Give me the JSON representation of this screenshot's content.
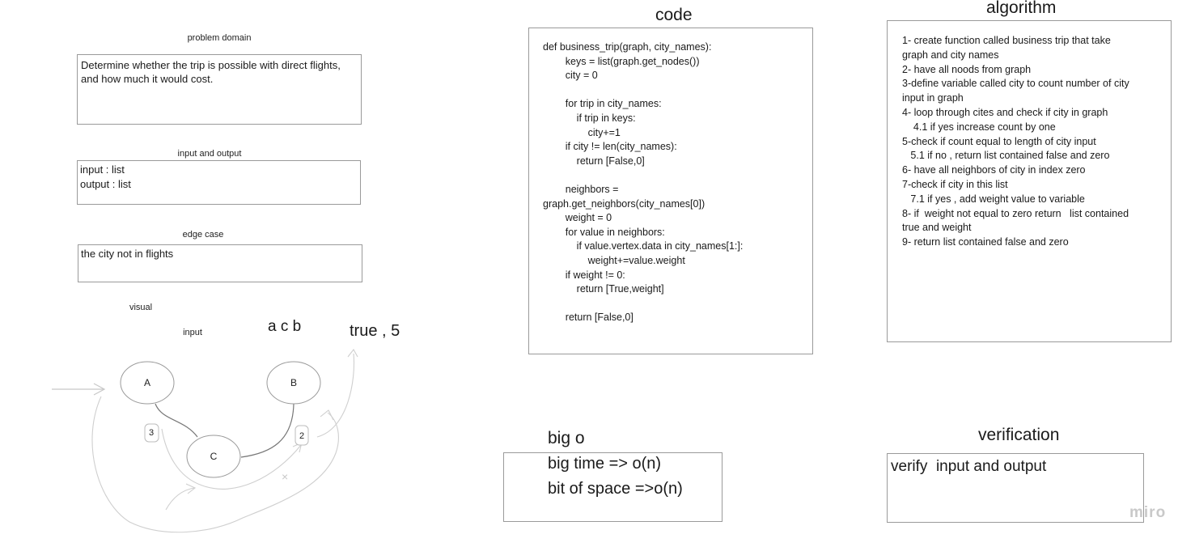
{
  "problem_domain": {
    "label": "problem domain",
    "text": "Determine whether the trip is possible with direct flights, and how much it would cost."
  },
  "input_output": {
    "label": "input and output",
    "lines": [
      "input : list",
      "output : list"
    ]
  },
  "edge_case": {
    "label": "edge case",
    "text": "the city not in flights"
  },
  "visual": {
    "label": "visual",
    "input_label": "input",
    "input_value": "a c b",
    "output_value": "true , 5",
    "nodes": [
      "A",
      "B",
      "C"
    ],
    "edge_weights": [
      "3",
      "2"
    ],
    "cross_mark": "×"
  },
  "code": {
    "title": "code",
    "lines": [
      "def business_trip(graph, city_names):",
      "        keys = list(graph.get_nodes())",
      "        city = 0",
      "",
      "        for trip in city_names:",
      "            if trip in keys:",
      "                city+=1",
      "        if city != len(city_names):",
      "            return [False,0]",
      "",
      "        neighbors =",
      "graph.get_neighbors(city_names[0])",
      "        weight = 0",
      "        for value in neighbors:",
      "            if value.vertex.data in city_names[1:]:",
      "                weight+=value.weight",
      "        if weight != 0:",
      "            return [True,weight]",
      "",
      "        return [False,0]"
    ]
  },
  "algorithm": {
    "title": "algorithm",
    "lines": [
      "1- create function called business trip that take",
      "graph and city names",
      "2- have all noods from graph",
      "3-define variable called city to count number of city",
      "input in graph",
      "4- loop through cites and check if city in graph",
      "    4.1 if yes increase count by one",
      "5-check if count equal to length of city input",
      "   5.1 if no , return list contained false and zero",
      "6- have all neighbors of city in index zero",
      "7-check if city in this list",
      "   7.1 if yes , add weight value to variable",
      "8- if  weight not equal to zero return   list contained",
      "true and weight",
      "9- return list contained false and zero"
    ]
  },
  "big_o": {
    "title": "big o",
    "lines": [
      "big time => o(n)",
      "bit of space =>o(n)"
    ]
  },
  "verification": {
    "title": "verification",
    "text": "verify  input and output"
  },
  "watermark": "miro"
}
